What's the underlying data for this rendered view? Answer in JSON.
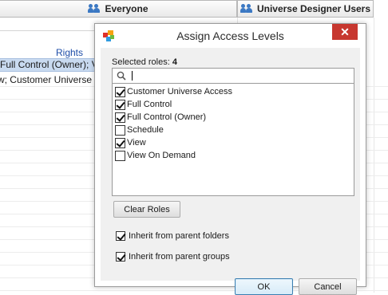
{
  "background": {
    "tabs": [
      {
        "label": "Everyone",
        "icon": "users-icon"
      },
      {
        "label": "Universe Designer Users",
        "icon": "users-icon"
      }
    ],
    "column_header": "Rights",
    "rows": [
      {
        "text": "Full Control (Owner); V"
      },
      {
        "text": "iew; Customer Universe"
      }
    ]
  },
  "dialog": {
    "title": "Assign Access Levels",
    "close_icon": "close-icon",
    "app_icon": "app-logo-icon",
    "selected_roles_label": "Selected roles:",
    "selected_roles_count": "4",
    "search": {
      "value": "",
      "placeholder": "",
      "icon": "search-icon"
    },
    "roles": [
      {
        "label": "Customer Universe Access",
        "checked": true
      },
      {
        "label": "Full Control",
        "checked": true
      },
      {
        "label": "Full Control (Owner)",
        "checked": true
      },
      {
        "label": "Schedule",
        "checked": false
      },
      {
        "label": "View",
        "checked": true
      },
      {
        "label": "View On Demand",
        "checked": false
      }
    ],
    "clear_roles_label": "Clear Roles",
    "inherit_folders_label": "Inherit from parent folders",
    "inherit_folders_checked": true,
    "inherit_groups_label": "Inherit from parent groups",
    "inherit_groups_checked": true,
    "ok_label": "OK",
    "cancel_label": "Cancel"
  },
  "colors": {
    "close_button": "#c7372f",
    "selection_row": "#c9daf0",
    "link_text": "#1f4ea8"
  }
}
